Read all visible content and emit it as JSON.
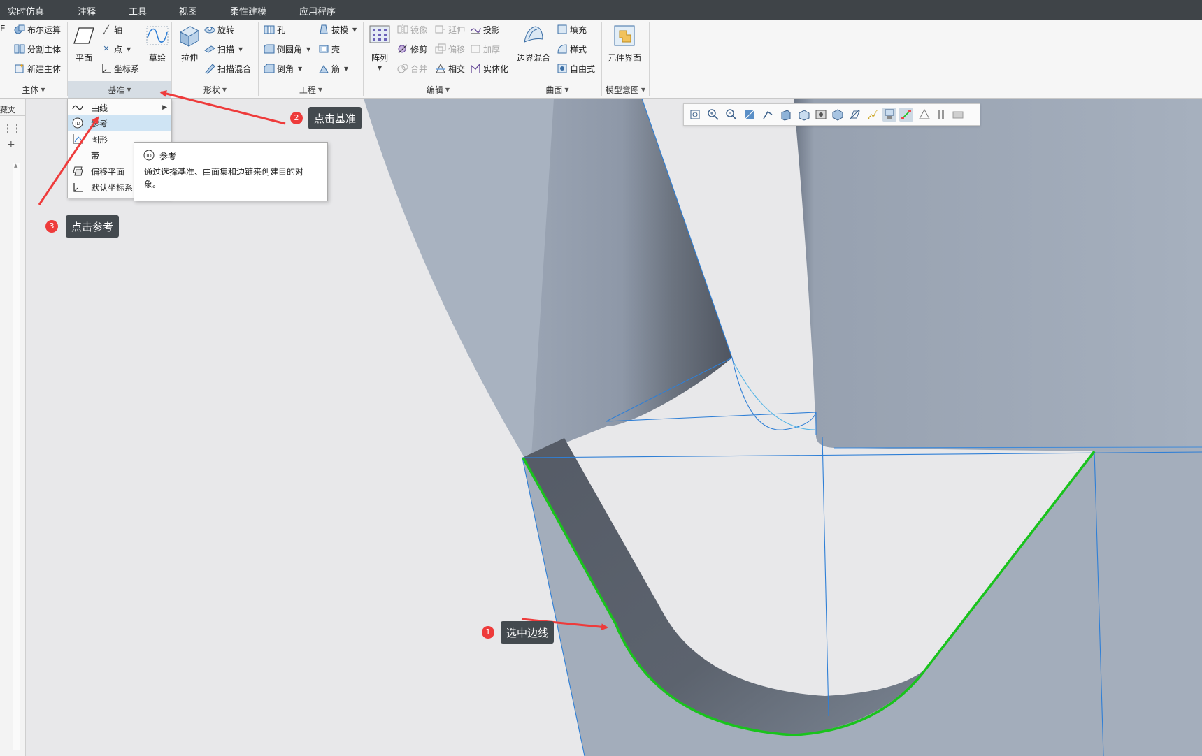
{
  "menubar": {
    "tabs": [
      "实时仿真",
      "注释",
      "工具",
      "视图",
      "柔性建模",
      "应用程序"
    ]
  },
  "ribbon": {
    "groups": {
      "body": {
        "label": "主体",
        "partial_icon_text": "E",
        "items": [
          "布尔运算",
          "分割主体",
          "新建主体"
        ]
      },
      "datum": {
        "label": "基准",
        "plane": "平面",
        "axis": "轴",
        "point": "点",
        "csys": "坐标系",
        "sketch": "草绘"
      },
      "shapes": {
        "label": "形状",
        "extrude": "拉伸",
        "revolve": "旋转",
        "sweep": "扫描",
        "swept_blend": "扫描混合"
      },
      "engineering": {
        "label": "工程",
        "hole": "孔",
        "round": "倒圆角",
        "chamfer": "倒角",
        "draft": "拔模",
        "shell": "壳",
        "rib": "筋"
      },
      "editing": {
        "label": "编辑",
        "pattern": "阵列",
        "mirror": "镜像",
        "extend": "延伸",
        "project": "投影",
        "trim": "修剪",
        "offset": "偏移",
        "thicken": "加厚",
        "merge": "合并",
        "intersect": "相交",
        "solidify": "实体化"
      },
      "surfaces": {
        "label": "曲面",
        "boundary_blend": "边界混合",
        "fill": "填充",
        "style": "样式",
        "freestyle": "自由式"
      },
      "model_intent": {
        "label": "模型意图",
        "component_interface": "元件界面"
      }
    }
  },
  "leftpanel": {
    "partial_label": "藏夹"
  },
  "datum_menu": {
    "items": [
      "曲线",
      "参考",
      "图形",
      "带",
      "偏移平面",
      "默认坐标系"
    ],
    "highlighted": "参考"
  },
  "tooltip": {
    "title": "参考",
    "body": "通过选择基准、曲面集和边链来创建目的对象。"
  },
  "callouts": [
    {
      "number": "1",
      "text": "选中边线"
    },
    {
      "number": "2",
      "text": "点击基准"
    },
    {
      "number": "3",
      "text": "点击参考"
    }
  ],
  "colors": {
    "menubar_bg": "#3f4448",
    "selected_edge": "#19c31c",
    "callout_bg": "#444a4f",
    "badge": "#ee3b3b",
    "arrow": "#ee3b3b",
    "surface_light": "#a3adbb",
    "surface_dark": "#585f6b",
    "wire_blue": "#2f7fd6"
  }
}
